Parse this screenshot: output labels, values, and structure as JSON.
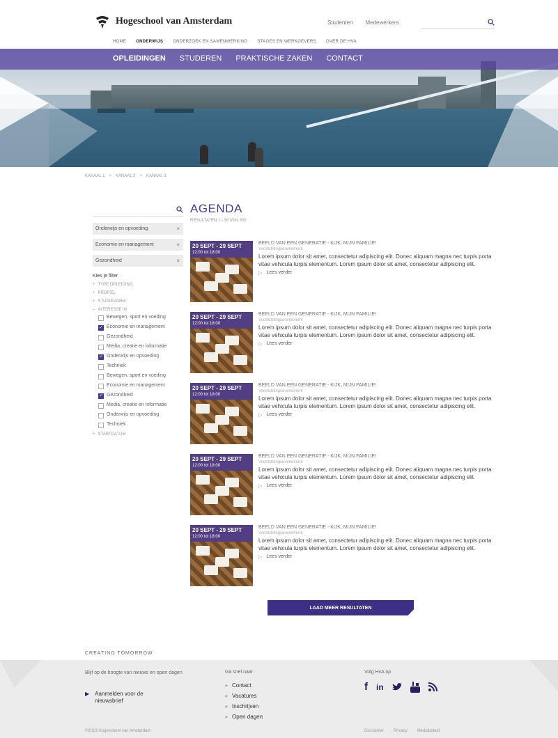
{
  "header": {
    "logo_text": "Hogeschool van Amsterdam",
    "top_links": [
      "Studenten",
      "Medewerkers"
    ],
    "search_placeholder": "",
    "mainnav": [
      "HOME",
      "ONDERWIJS",
      "ONDERZOEK EN SAMENWERKING",
      "STAGES EN WERKGEVERS",
      "OVER DE HVA"
    ],
    "mainnav_active": "ONDERWIJS"
  },
  "subnav": {
    "items": [
      "OPLEIDINGEN",
      "STUDEREN",
      "PRAKTISCHE ZAKEN",
      "CONTACT"
    ],
    "active": "OPLEIDINGEN"
  },
  "breadcrumb": [
    "KANAAL 1",
    "KANAAL 2",
    "KANAAL 3"
  ],
  "sidebar": {
    "active_filters": [
      "Onderwijs en opvoeding",
      "Economie en management",
      "Gezondheid"
    ],
    "filter_title": "Kies je filter",
    "groups": [
      "TYPE OPLEIDING",
      "PROFIEL",
      "STUDIEVORM",
      "INTERESSE IN",
      "STARTDATUM"
    ],
    "group_prefix_closed": "+",
    "group_prefix_open": "–",
    "interest_options": [
      {
        "label": "Bewegen, sport en voeding",
        "checked": false
      },
      {
        "label": "Economie en management",
        "checked": true
      },
      {
        "label": "Gezondheid",
        "checked": false
      },
      {
        "label": "Media, creatie en informatie",
        "checked": false
      },
      {
        "label": "Onderwijs en opvoeding",
        "checked": true
      },
      {
        "label": "Techniek",
        "checked": false
      },
      {
        "label": "Bewegen, sport en voeding",
        "checked": false
      },
      {
        "label": "Economie en management",
        "checked": false
      },
      {
        "label": "Gezondheid",
        "checked": true
      },
      {
        "label": "Media, creatie en informatie",
        "checked": false
      },
      {
        "label": "Onderwijs en opvoeding",
        "checked": false
      },
      {
        "label": "Techniek",
        "checked": false
      }
    ]
  },
  "content": {
    "title": "AGENDA",
    "results": "RESULTATEN 1 - 30 VAN 300",
    "items": [
      {
        "date": "20 SEPT - 29 SEPT",
        "time": "12:00 tot 18:00",
        "title": "BEELD VAN EEN GENERATIE - KIJK, MIJN FAMILIE!",
        "subtitle": "Voorlichtingsevenement",
        "desc": "Lorem ipsum dolor sit amet, consectetur adipiscing elit. Donec aliquam magna nec turpis porta vitae vehicula turpis elementum. Lorem ipsum dolor sit amet, consectetur adipiscing elit.",
        "more": "Lees verder"
      },
      {
        "date": "20 SEPT - 29 SEPT",
        "time": "12:00 tot 18:00",
        "title": "BEELD VAN EEN GENERATIE - KIJK, MIJN FAMILIE!",
        "subtitle": "Voorlichtingsevenement",
        "desc": "Lorem ipsum dolor sit amet, consectetur adipiscing elit. Donec aliquam magna nec turpis porta vitae vehicula turpis elementum. Lorem ipsum dolor sit amet, consectetur adipiscing elit.",
        "more": "Lees verder"
      },
      {
        "date": "20 SEPT - 29 SEPT",
        "time": "12:00 tot 18:00",
        "title": "BEELD VAN EEN GENERATIE - KIJK, MIJN FAMILIE!",
        "subtitle": "Voorlichtingsevenement",
        "desc": "Lorem ipsum dolor sit amet, consectetur adipiscing elit. Donec aliquam magna nec turpis porta vitae vehicula turpis elementum. Lorem ipsum dolor sit amet, consectetur adipiscing elit.",
        "more": "Lees verder"
      },
      {
        "date": "20 SEPT - 29 SEPT",
        "time": "12:00 tot 18:00",
        "title": "BEELD VAN EEN GENERATIE - KIJK, MIJN FAMILIE!",
        "subtitle": "Voorlichtingsevenement",
        "desc": "Lorem ipsum dolor sit amet, consectetur adipiscing elit. Donec aliquam magna nec turpis porta vitae vehicula turpis elementum. Lorem ipsum dolor sit amet, consectetur adipiscing elit.",
        "more": "Lees verder"
      },
      {
        "date": "20 SEPT - 29 SEPT",
        "time": "12:00 tot 18:00",
        "title": "BEELD VAN EEN GENERATIE - KIJK, MIJN FAMILIE!",
        "subtitle": "Voorlichtingsevenement",
        "desc": "Lorem ipsum dolor sit amet, consectetur adipiscing elit. Donec aliquam magna nec turpis porta vitae vehicula turpis elementum. Lorem ipsum dolor sit amet, consectetur adipiscing elit.",
        "more": "Lees verder"
      }
    ],
    "load_more": "LAAD MEER RESULTATEN"
  },
  "footer": {
    "tagline": "CREATING TOMORROW",
    "col1_text": "Blijf op de hoogte van nieuws en open dagen",
    "newsletter": "Aanmelden voor de nieuwsbrief",
    "col2_title": "Ga snel naar",
    "quick_links": [
      "Contact",
      "Vacatures",
      "Inschrijven",
      "Open dagen"
    ],
    "col3_title": "Volg HvA op",
    "social": [
      "facebook-icon",
      "linkedin-icon",
      "twitter-icon",
      "youtube-icon",
      "rss-icon"
    ],
    "copyright": "©2013 Hogeschool van Amsterdam",
    "legal": [
      "Disclaimer",
      "Privacy",
      "Mediabeleid"
    ]
  },
  "colors": {
    "accent": "#4b3a8f",
    "footer_bg": "#ececec"
  }
}
